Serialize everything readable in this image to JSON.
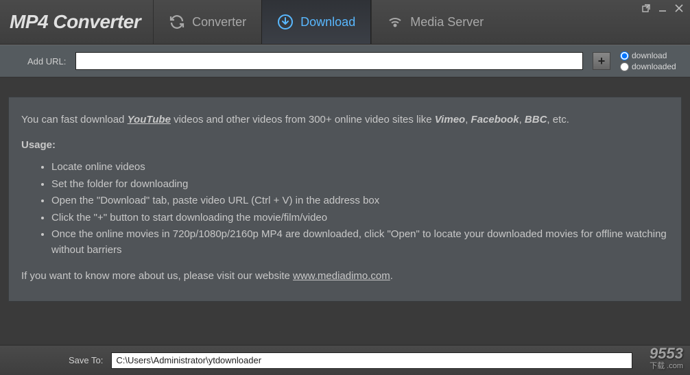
{
  "app": {
    "title": "MP4 Converter"
  },
  "tabs": {
    "converter": "Converter",
    "download": "Download",
    "media_server": "Media Server"
  },
  "url_bar": {
    "label": "Add URL:",
    "value": "",
    "add_button": "+",
    "radio_download": "download",
    "radio_downloaded": "downloaded"
  },
  "info": {
    "intro_prefix": "You can fast download ",
    "youtube": "YouTube",
    "intro_mid": " videos and other videos from 300+ online video sites like ",
    "site1": "Vimeo",
    "sep1": ", ",
    "site2": "Facebook",
    "sep2": ", ",
    "site3": "BBC",
    "intro_suffix": ", etc.",
    "usage_heading": "Usage:",
    "steps": [
      "Locate online videos",
      "Set the folder for downloading",
      "Open the \"Download\" tab, paste video URL (Ctrl + V) in the address box",
      "Click the \"+\" button to start downloading the movie/film/video",
      "Once the online movies in 720p/1080p/2160p MP4 are downloaded, click \"Open\" to locate your downloaded movies for offline watching without barriers"
    ],
    "more_prefix": "If you want to know more about us, please visit our website ",
    "more_link": "www.mediadimo.com",
    "more_suffix": "."
  },
  "save": {
    "label": "Save To:",
    "path": "C:\\Users\\Administrator\\ytdownloader"
  },
  "watermark": {
    "main": "9553",
    "sub": "下载 .com"
  }
}
